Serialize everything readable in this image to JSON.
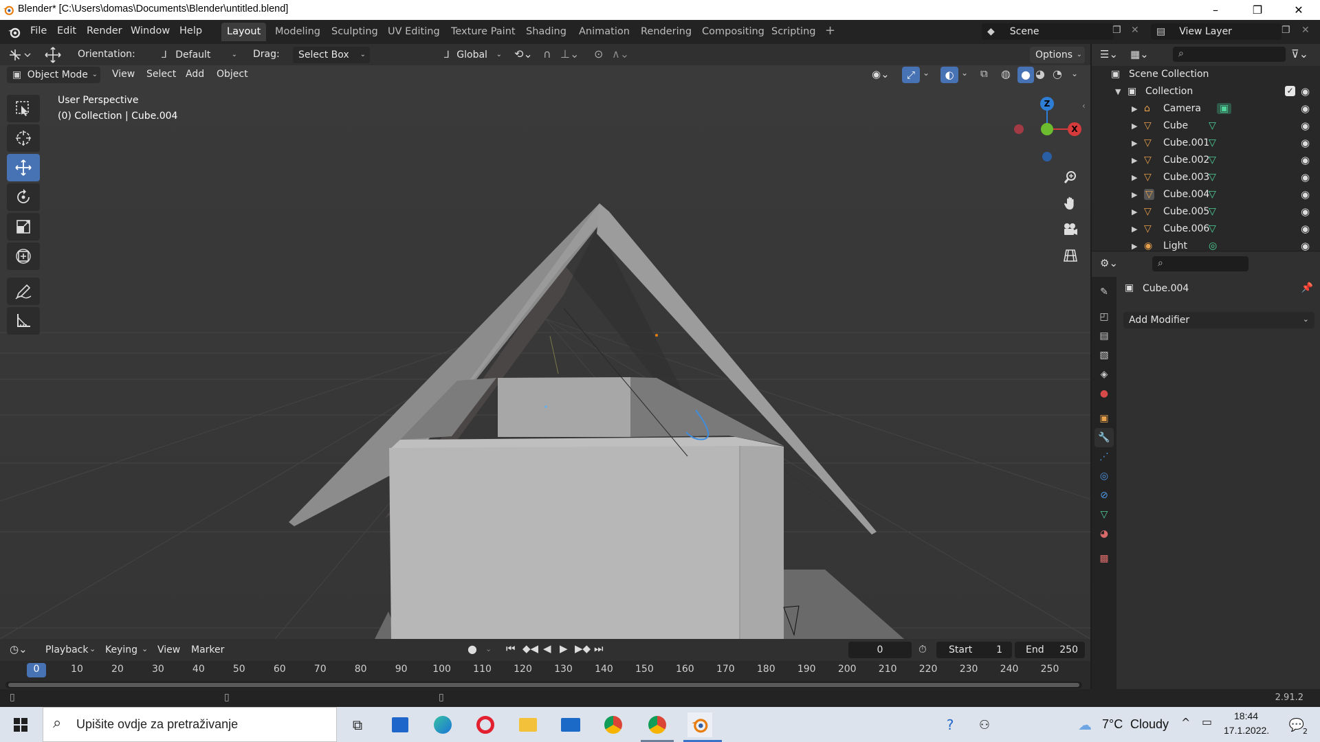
{
  "window": {
    "title": "Blender* [C:\\Users\\domas\\Documents\\Blender\\untitled.blend]",
    "minimize": "–",
    "restore": "❐",
    "close": "✕"
  },
  "menu": [
    "File",
    "Edit",
    "Render",
    "Window",
    "Help"
  ],
  "workspaces": [
    "Layout",
    "Modeling",
    "Sculpting",
    "UV Editing",
    "Texture Paint",
    "Shading",
    "Animation",
    "Rendering",
    "Compositing",
    "Scripting"
  ],
  "add_workspace": "+",
  "scene": {
    "name": "Scene",
    "view_layer": "View Layer"
  },
  "tool_header": {
    "orientation_label": "Orientation:",
    "orientation_value": "Default",
    "drag_label": "Drag:",
    "drag_value": "Select Box",
    "transform_orientation": "Global",
    "options": "Options"
  },
  "viewport_header": {
    "mode": "Object Mode",
    "menus": [
      "View",
      "Select",
      "Add",
      "Object"
    ]
  },
  "viewport": {
    "perspective": "User Perspective",
    "collection_info": "(0) Collection | Cube.004",
    "gizmo": {
      "z": "Z",
      "x": "X"
    }
  },
  "outliner": {
    "root": "Scene Collection",
    "collection": "Collection",
    "items": [
      {
        "name": "Camera",
        "type": "camera"
      },
      {
        "name": "Cube",
        "type": "mesh"
      },
      {
        "name": "Cube.001",
        "type": "mesh"
      },
      {
        "name": "Cube.002",
        "type": "mesh"
      },
      {
        "name": "Cube.003",
        "type": "mesh"
      },
      {
        "name": "Cube.004",
        "type": "mesh",
        "selected": true
      },
      {
        "name": "Cube.005",
        "type": "mesh"
      },
      {
        "name": "Cube.006",
        "type": "mesh"
      },
      {
        "name": "Light",
        "type": "light"
      }
    ]
  },
  "properties": {
    "object_name": "Cube.004",
    "add_modifier": "Add Modifier"
  },
  "timeline": {
    "menus": [
      "Playback",
      "Keying",
      "View",
      "Marker"
    ],
    "current_frame": "0",
    "start_label": "Start",
    "start": "1",
    "end_label": "End",
    "end": "250",
    "ticks": [
      "0",
      "10",
      "20",
      "30",
      "40",
      "50",
      "60",
      "70",
      "80",
      "90",
      "100",
      "110",
      "120",
      "130",
      "140",
      "150",
      "160",
      "170",
      "180",
      "190",
      "200",
      "210",
      "220",
      "230",
      "240",
      "250"
    ]
  },
  "status": {
    "version": "2.91.2"
  },
  "taskbar": {
    "search_placeholder": "Upišite ovdje za pretraživanje",
    "weather_temp": "7°C",
    "weather_desc": "Cloudy",
    "time": "18:44",
    "date": "17.1.2022.",
    "notifications": "2"
  },
  "colors": {
    "accent": "#4772b3",
    "selected_row": "#334d80",
    "blender_orange": "#e87d0d",
    "mesh_icon": "#e8a04a",
    "data_icon": "#4fd39b"
  }
}
